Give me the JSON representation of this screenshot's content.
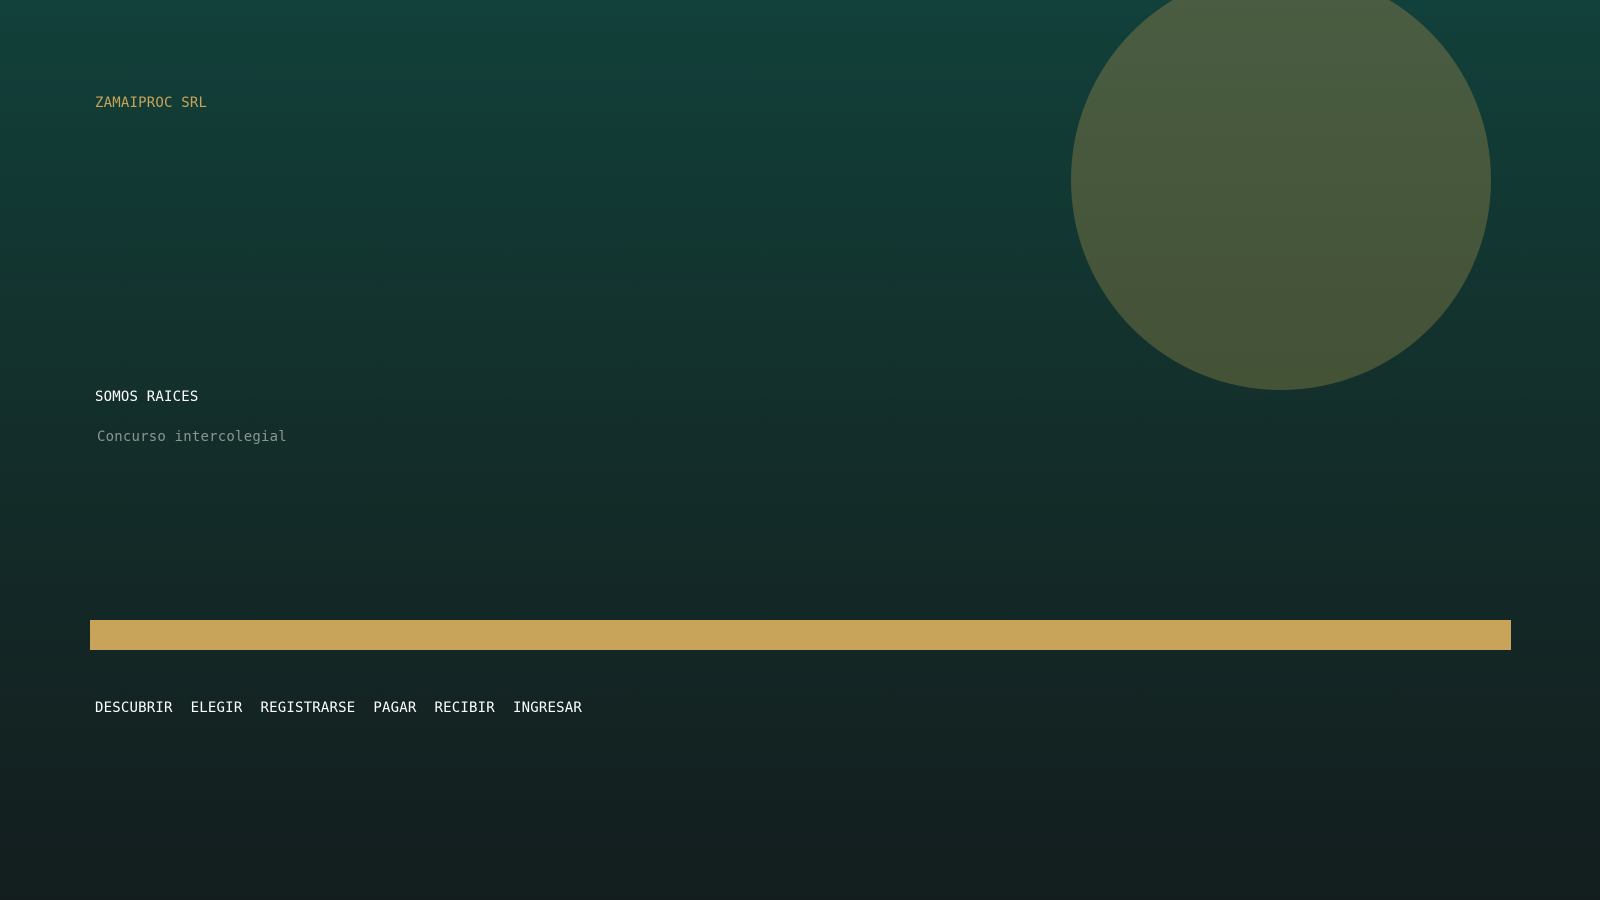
{
  "brand": {
    "name": "ZAMAIPROC SRL"
  },
  "hero": {
    "title": "SOMOS RAICES",
    "subtitle": "Concurso intercolegial"
  },
  "steps": [
    {
      "label": "DESCUBRIR"
    },
    {
      "label": "ELEGIR"
    },
    {
      "label": "REGISTRARSE"
    },
    {
      "label": "PAGAR"
    },
    {
      "label": "RECIBIR"
    },
    {
      "label": "INGRESAR"
    }
  ],
  "colors": {
    "accent": "#c7a45a",
    "background_top": "#12403a",
    "background_bottom": "#131d1e",
    "circle": "#4a5d42",
    "bar": "#c7a45a"
  }
}
